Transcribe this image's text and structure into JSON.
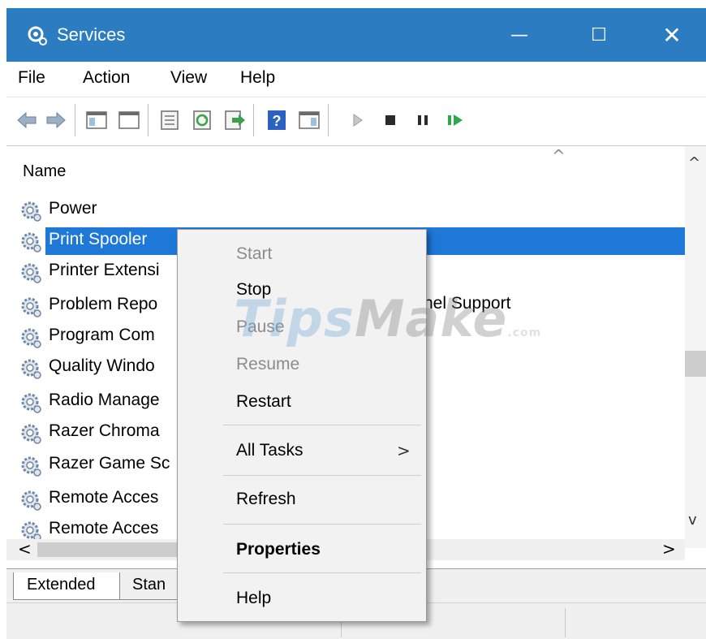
{
  "window": {
    "title": "Services",
    "minimize_glyph": "—",
    "maximize_glyph": "☐",
    "close_glyph": "✕"
  },
  "menu": {
    "file": "File",
    "action": "Action",
    "view": "View",
    "help": "Help"
  },
  "toolbar": {
    "icons": [
      "back-arrow-icon",
      "forward-arrow-icon",
      "show-hide-console-tree-icon",
      "properties-icon",
      "refresh-icon",
      "export-list-icon",
      "help-icon",
      "show-action-pane-icon",
      "start-service-icon",
      "stop-service-icon",
      "pause-service-icon",
      "resume-service-icon"
    ]
  },
  "list": {
    "column_name": "Name",
    "sort_glyph": "^",
    "selected_color": "#1e78d8",
    "rows": [
      {
        "name": "Power"
      },
      {
        "name": "Print Spooler"
      },
      {
        "name": "Printer Extensi"
      },
      {
        "name": "Problem Repo"
      },
      {
        "name": "Program Com"
      },
      {
        "name": "Quality Windo"
      },
      {
        "name": "Radio Manage"
      },
      {
        "name": "Razer Chroma"
      },
      {
        "name": "Razer Game Sc"
      },
      {
        "name": "Remote Acces"
      },
      {
        "name": "Remote Acces"
      }
    ],
    "partial_text": "nel Support"
  },
  "scroll": {
    "up": "^",
    "down": "v",
    "left": "<",
    "right": ">"
  },
  "tabs": {
    "extended": "Extended",
    "standard": "Stan"
  },
  "context_menu": {
    "start": "Start",
    "stop": "Stop",
    "pause": "Pause",
    "resume": "Resume",
    "restart": "Restart",
    "all_tasks": "All Tasks",
    "all_tasks_arrow": ">",
    "refresh": "Refresh",
    "properties": "Properties",
    "help": "Help"
  },
  "watermark": {
    "part_a": "Tips",
    "part_b": "Make",
    "part_c": ".com"
  }
}
